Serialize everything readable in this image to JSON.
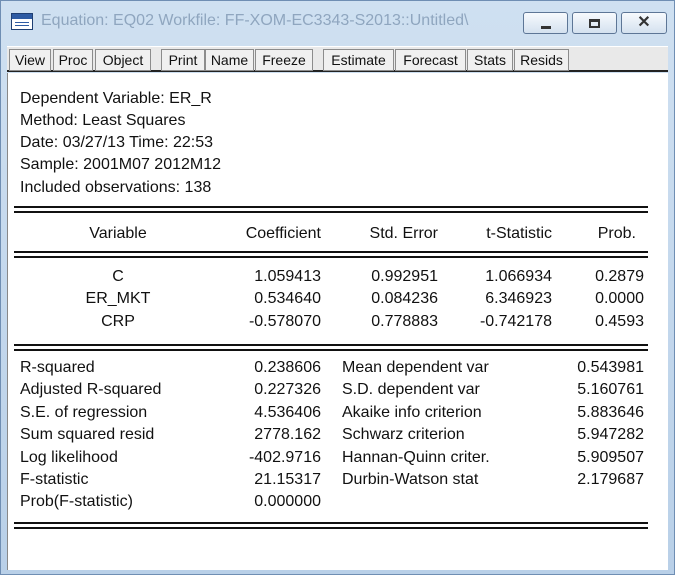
{
  "window": {
    "title": "Equation: EQ02   Workfile: FF-XOM-EC3343-S2013::Untitled\\"
  },
  "toolbar": {
    "buttons": [
      "View",
      "Proc",
      "Object",
      "Print",
      "Name",
      "Freeze",
      "Estimate",
      "Forecast",
      "Stats",
      "Resids"
    ]
  },
  "header": [
    "Dependent Variable: ER_R",
    "Method: Least Squares",
    "Date: 03/27/13   Time: 22:53",
    "Sample: 2001M07 2012M12",
    "Included observations: 138"
  ],
  "coef_table": {
    "columns": [
      "Variable",
      "Coefficient",
      "Std. Error",
      "t-Statistic",
      "Prob."
    ],
    "rows": [
      [
        "C",
        "1.059413",
        "0.992951",
        "1.066934",
        "0.2879"
      ],
      [
        "ER_MKT",
        "0.534640",
        "0.084236",
        "6.346923",
        "0.0000"
      ],
      [
        "CRP",
        "-0.578070",
        "0.778883",
        "-0.742178",
        "0.4593"
      ]
    ]
  },
  "stats": {
    "left": [
      [
        "R-squared",
        "0.238606"
      ],
      [
        "Adjusted R-squared",
        "0.227326"
      ],
      [
        "S.E. of regression",
        "4.536406"
      ],
      [
        "Sum squared resid",
        "2778.162"
      ],
      [
        "Log likelihood",
        "-402.9716"
      ],
      [
        "F-statistic",
        "21.15317"
      ],
      [
        "Prob(F-statistic)",
        "0.000000"
      ]
    ],
    "right": [
      [
        "Mean dependent var",
        "0.543981"
      ],
      [
        "S.D. dependent var",
        "5.160761"
      ],
      [
        "Akaike info criterion",
        "5.883646"
      ],
      [
        "Schwarz criterion",
        "5.947282"
      ],
      [
        "Hannan-Quinn criter.",
        "5.909507"
      ],
      [
        "Durbin-Watson stat",
        "2.179687"
      ]
    ]
  }
}
